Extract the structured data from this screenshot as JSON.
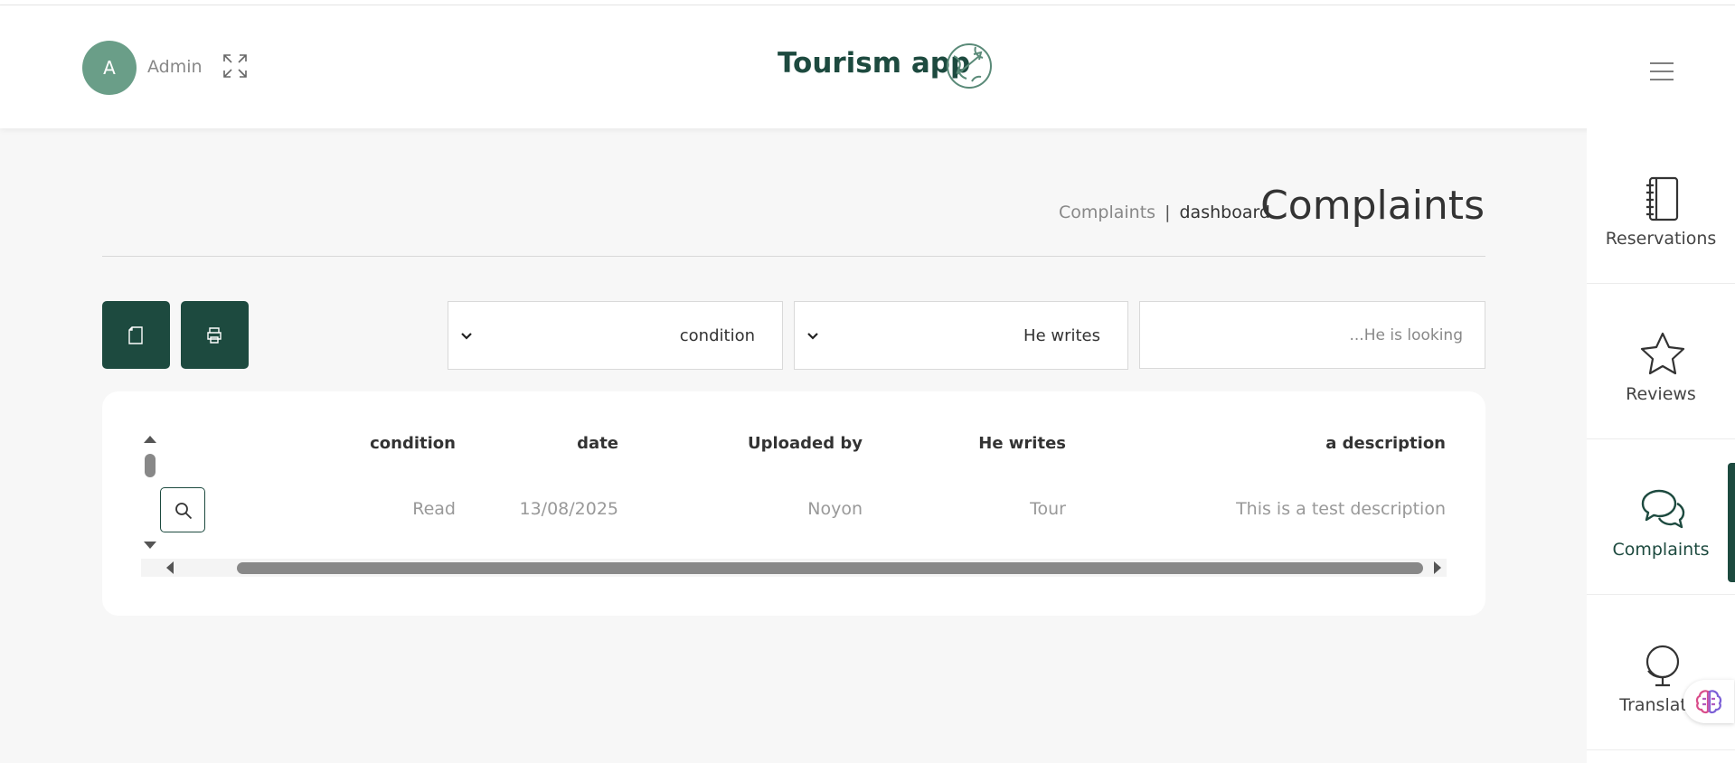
{
  "header": {
    "avatar_initial": "A",
    "user_name": "Admin",
    "app_title": "Tourism app"
  },
  "sidebar": {
    "items": [
      {
        "label": "Reservations",
        "icon": "notebook-icon"
      },
      {
        "label": "Reviews",
        "icon": "star-icon"
      },
      {
        "label": "Complaints",
        "icon": "chat-bubbles-icon",
        "active": true
      },
      {
        "label": "Translatio",
        "icon": "globe-stand-icon"
      }
    ]
  },
  "breadcrumb": {
    "link": "Complaints",
    "separator": "|",
    "current": "dashboard"
  },
  "page": {
    "title": "Complaints"
  },
  "filters": {
    "condition_value": "condition",
    "writes_value": "He writes",
    "search_placeholder": "...He is looking"
  },
  "table": {
    "headers": [
      "condition",
      "date",
      "Uploaded by",
      "He writes",
      "a description"
    ],
    "rows": [
      [
        "Read",
        "13/08/2025",
        "Noyon",
        "Tour",
        "This is a test description"
      ]
    ]
  },
  "colors": {
    "primary": "#1d4a3f",
    "avatar": "#6a9e88",
    "background": "#f7f7f7"
  }
}
